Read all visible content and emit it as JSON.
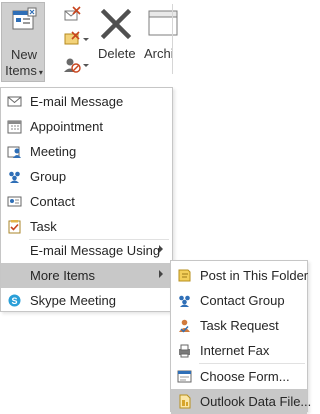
{
  "ribbon": {
    "new_items_line1": "New",
    "new_items_line2": "Items",
    "delete_label": "Delete",
    "archive_label": "Archi"
  },
  "main_menu": {
    "items": [
      {
        "label": "E-mail Message",
        "icon": "email-icon"
      },
      {
        "label": "Appointment",
        "icon": "calendar-icon"
      },
      {
        "label": "Meeting",
        "icon": "meeting-icon"
      },
      {
        "label": "Group",
        "icon": "group-icon"
      },
      {
        "label": "Contact",
        "icon": "contact-card-icon"
      },
      {
        "label": "Task",
        "icon": "task-check-icon"
      },
      {
        "label": "E-mail Message Using",
        "icon": "",
        "has_submenu": true
      },
      {
        "label": "More Items",
        "icon": "",
        "has_submenu": true,
        "highlighted": true
      },
      {
        "label": "Skype Meeting",
        "icon": "skype-icon"
      }
    ]
  },
  "sub_menu": {
    "items": [
      {
        "label": "Post in This Folder",
        "icon": "post-note-icon"
      },
      {
        "label": "Contact Group",
        "icon": "contact-group-icon"
      },
      {
        "label": "Task Request",
        "icon": "task-request-icon"
      },
      {
        "label": "Internet Fax",
        "icon": "fax-icon"
      },
      {
        "label": "Choose Form...",
        "icon": "form-icon"
      },
      {
        "label": "Outlook Data File...",
        "icon": "data-file-icon",
        "highlighted": true
      }
    ]
  },
  "colors": {
    "highlight": "#c8c8c8",
    "menu_border": "#c6c6c6",
    "text": "#262626",
    "accent_blue": "#2f6fb7"
  }
}
